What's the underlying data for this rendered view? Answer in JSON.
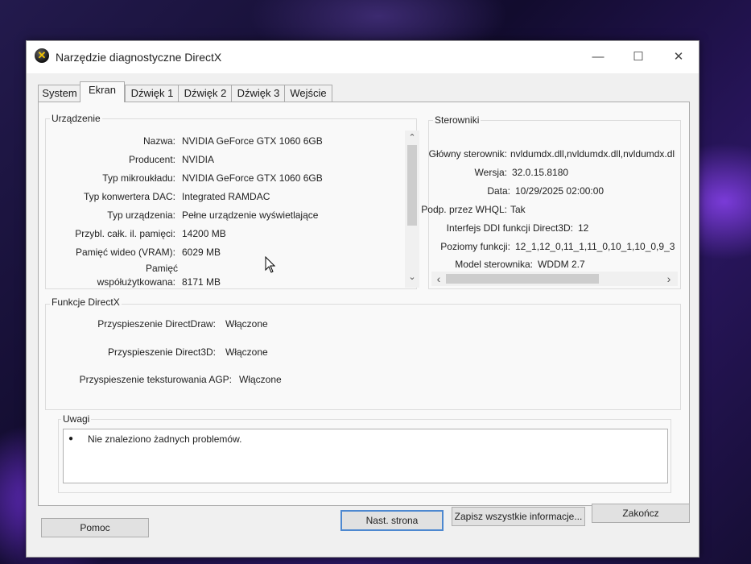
{
  "window": {
    "title": "Narzędzie diagnostyczne DirectX"
  },
  "title_buttons": {
    "minimize": "—",
    "maximize": "☐",
    "close": "✕"
  },
  "tabs": [
    {
      "label": "System"
    },
    {
      "label": "Ekran"
    },
    {
      "label": "Dźwięk 1"
    },
    {
      "label": "Dźwięk 2"
    },
    {
      "label": "Dźwięk 3"
    },
    {
      "label": "Wejście"
    }
  ],
  "device": {
    "title": "Urządzenie",
    "rows": [
      {
        "label": "Nazwa:",
        "value": "NVIDIA GeForce GTX 1060 6GB"
      },
      {
        "label": "Producent:",
        "value": "NVIDIA"
      },
      {
        "label": "Typ mikroukładu:",
        "value": "NVIDIA GeForce GTX 1060 6GB"
      },
      {
        "label": "Typ konwertera DAC:",
        "value": "Integrated RAMDAC"
      },
      {
        "label": "Typ urządzenia:",
        "value": "Pełne urządzenie wyświetlające"
      },
      {
        "label": "Przybl. całk. il. pamięci:",
        "value": "14200 MB"
      },
      {
        "label": "Pamięć wideo (VRAM):",
        "value": "6029 MB"
      },
      {
        "label": "Pamięć",
        "label2": "współużytkowana:",
        "value": "8171 MB"
      }
    ]
  },
  "drivers": {
    "title": "Sterowniki",
    "rows": [
      {
        "label": "Główny sterownik:",
        "value": "nvldumdx.dll,nvldumdx.dll,nvldumdx.dll"
      },
      {
        "label": "Wersja:",
        "value": "32.0.15.8180"
      },
      {
        "label": "Data:",
        "value": "10/29/2025 02:00:00"
      },
      {
        "label": "Podp. przez WHQL:",
        "value": "Tak"
      },
      {
        "label": "Interfejs DDI funkcji Direct3D:",
        "value": "12"
      },
      {
        "label": "Poziomy funkcji:",
        "value": "12_1,12_0,11_1,11_0,10_1,10_0,9_3"
      },
      {
        "label": "Model sterownika:",
        "value": "WDDM 2.7"
      }
    ]
  },
  "directx_features": {
    "title": "Funkcje DirectX",
    "rows": [
      {
        "label": "Przyspieszenie DirectDraw:",
        "value": "Włączone"
      },
      {
        "label": "Przyspieszenie Direct3D:",
        "value": "Włączone"
      },
      {
        "label": "Przyspieszenie teksturowania AGP:",
        "value": "Włączone"
      }
    ]
  },
  "notes": {
    "title": "Uwagi",
    "items": [
      "Nie znaleziono żadnych problemów."
    ]
  },
  "buttons": {
    "help": "Pomoc",
    "next_page": "Nast. strona",
    "save_all": "Zapisz wszystkie informacje...",
    "exit": "Zakończ"
  },
  "scroll": {
    "up": "⌃",
    "down": "⌄",
    "left": "‹",
    "right": "›"
  },
  "icons": {
    "app": "directx-icon",
    "cursor": "mouse-pointer-icon"
  }
}
